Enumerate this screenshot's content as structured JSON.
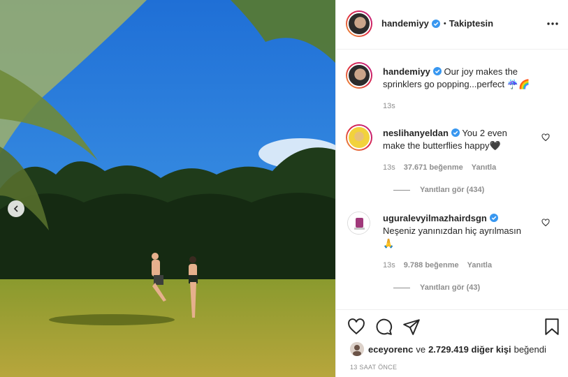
{
  "post": {
    "username": "handemiyy",
    "follow_status": "Takiptesin",
    "separator": "•",
    "caption": "Our joy makes the sprinklers go popping...perfect ☔️🌈",
    "caption_time": "13s"
  },
  "comments": [
    {
      "username": "neslihanyeldan",
      "text": "You 2 even make the butterflies happy🖤",
      "time": "13s",
      "likes": "37.671 beğenme",
      "reply_label": "Yanıtla",
      "view_replies": "Yanıtları gör (434)"
    },
    {
      "username": "uguralevyilmazhairdsgn",
      "text": "Neşeniz yanınızdan hiç ayrılmasın 🙏",
      "time": "13s",
      "likes": "9.788 beğenme",
      "reply_label": "Yanıtla",
      "view_replies": "Yanıtları gör (43)"
    }
  ],
  "likes_summary": {
    "first_user": "eceyorenc",
    "connector": "ve",
    "others": "2.729.419 diğer kişi",
    "suffix": "beğendi"
  },
  "post_time": "13 SAAT ÖNCE",
  "icons": {
    "more": "more-options-icon",
    "verified": "verified-badge-icon",
    "like": "heart-icon",
    "comment": "comment-bubble-icon",
    "share": "paper-plane-icon",
    "save": "bookmark-icon",
    "prev": "chevron-left-icon"
  },
  "colors": {
    "verified": "#3897f0",
    "text": "#262626",
    "muted": "#8e8e8e",
    "border": "#efefef"
  }
}
